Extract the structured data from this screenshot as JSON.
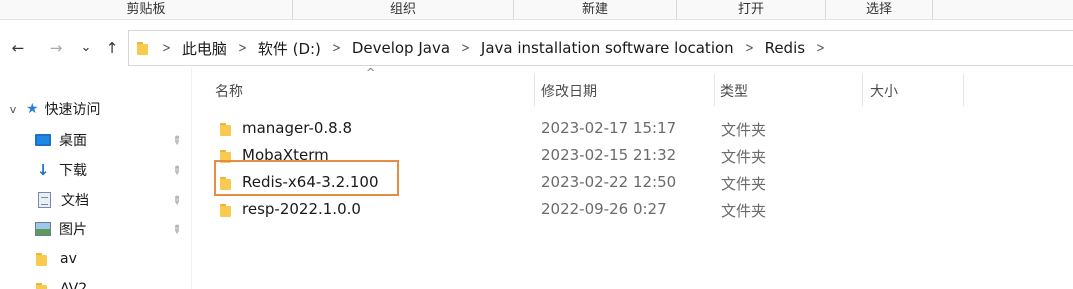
{
  "ribbon": {
    "groups": [
      {
        "label": "剪贴板"
      },
      {
        "label": "组织"
      },
      {
        "label": "新建"
      },
      {
        "label": "打开"
      },
      {
        "label": "选择"
      }
    ]
  },
  "nav_buttons": {
    "back": "←",
    "forward": "→",
    "recent": "⌄",
    "up": "↑"
  },
  "breadcrumb": [
    "此电脑",
    "软件 (D:)",
    "Develop Java",
    "Java installation software location",
    "Redis"
  ],
  "navpane": {
    "quick_access": "快速访问",
    "items": [
      {
        "label": "桌面",
        "icon": "desktop-icon",
        "pinned": true
      },
      {
        "label": "下载",
        "icon": "download-icon",
        "pinned": true
      },
      {
        "label": "文档",
        "icon": "document-icon",
        "pinned": true
      },
      {
        "label": "图片",
        "icon": "pictures-icon",
        "pinned": true
      },
      {
        "label": "av",
        "icon": "folder-icon",
        "pinned": false
      },
      {
        "label": "AV2",
        "icon": "folder-icon",
        "pinned": false
      }
    ]
  },
  "columns": {
    "name": "名称",
    "modified": "修改日期",
    "type": "类型",
    "size": "大小"
  },
  "files": [
    {
      "name": "manager-0.8.8",
      "modified": "2023-02-17 15:17",
      "type": "文件夹",
      "size": ""
    },
    {
      "name": "MobaXterm",
      "modified": "2023-02-15 21:32",
      "type": "文件夹",
      "size": ""
    },
    {
      "name": "Redis-x64-3.2.100",
      "modified": "2023-02-22 12:50",
      "type": "文件夹",
      "size": "",
      "highlighted": true
    },
    {
      "name": "resp-2022.1.0.0",
      "modified": "2022-09-26 0:27",
      "type": "文件夹",
      "size": ""
    }
  ],
  "colors": {
    "folder": "#f8ca4f",
    "highlight_border": "#e58d42",
    "quick_access_star": "#2b7fd6"
  }
}
